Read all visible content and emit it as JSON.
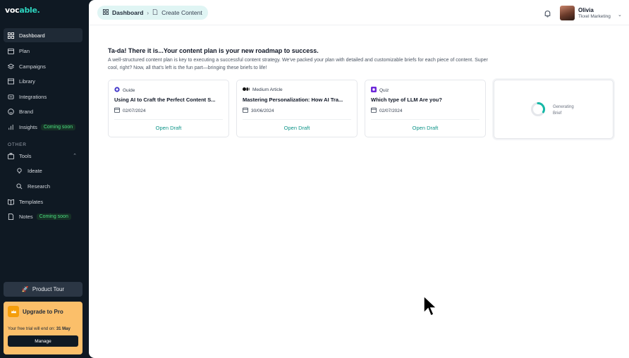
{
  "app": {
    "logo_main": "voc",
    "logo_accent": "able.",
    "brand_color": "#2dd4bf"
  },
  "sidebar": {
    "items": [
      {
        "label": "Dashboard",
        "icon": "grid-icon",
        "active": true
      },
      {
        "label": "Plan",
        "icon": "calendar-icon"
      },
      {
        "label": "Campaigns",
        "icon": "layers-icon"
      },
      {
        "label": "Library",
        "icon": "book-icon"
      },
      {
        "label": "Integrations",
        "icon": "plug-icon"
      },
      {
        "label": "Brand",
        "icon": "smile-icon"
      },
      {
        "label": "Insights",
        "icon": "chart-icon",
        "badge": "Coming soon"
      }
    ],
    "other_label": "OTHER",
    "tools": {
      "label": "Tools",
      "icon": "briefcase-icon",
      "expanded": true,
      "children": [
        {
          "label": "Ideate",
          "icon": "lightbulb-icon"
        },
        {
          "label": "Research",
          "icon": "search-icon"
        }
      ]
    },
    "bottom_items": [
      {
        "label": "Templates",
        "icon": "open-book-icon"
      },
      {
        "label": "Notes",
        "icon": "file-icon",
        "badge": "Coming soon"
      }
    ],
    "product_tour_label": "Product Tour",
    "upgrade": {
      "title": "Upgrade to Pro",
      "trial_text": "Your free trial will end on:",
      "trial_date": "31 May",
      "manage_label": "Manage"
    }
  },
  "header": {
    "breadcrumb": {
      "dashboard": "Dashboard",
      "current": "Create Content"
    },
    "user": {
      "name": "Olivia",
      "org": "Tkxel Marketing"
    }
  },
  "main": {
    "title": "Ta-da! There it is...Your content plan is your new roadmap to success.",
    "description": "A well-structured content plan is key to executing a successful content strategy. We've packed your plan with detailed and customizable briefs for each piece of content. Super cool, right? Now, all that's left is the fun part—bringing these briefs to life!",
    "cards": [
      {
        "type": "Guide",
        "type_icon": "guide-icon",
        "title": "Using AI to Craft the Perfect Content S...",
        "date": "02/07/2024",
        "action": "Open Draft"
      },
      {
        "type": "Medium Article",
        "type_icon": "medium-icon",
        "title": "Mastering Personalization: How AI Tra...",
        "date": "30/06/2024",
        "action": "Open Draft"
      },
      {
        "type": "Quiz",
        "type_icon": "quiz-icon",
        "title": "Which type of LLM Are you?",
        "date": "02/07/2024",
        "action": "Open Draft"
      }
    ],
    "generating": {
      "text": "Generating Brief"
    }
  }
}
